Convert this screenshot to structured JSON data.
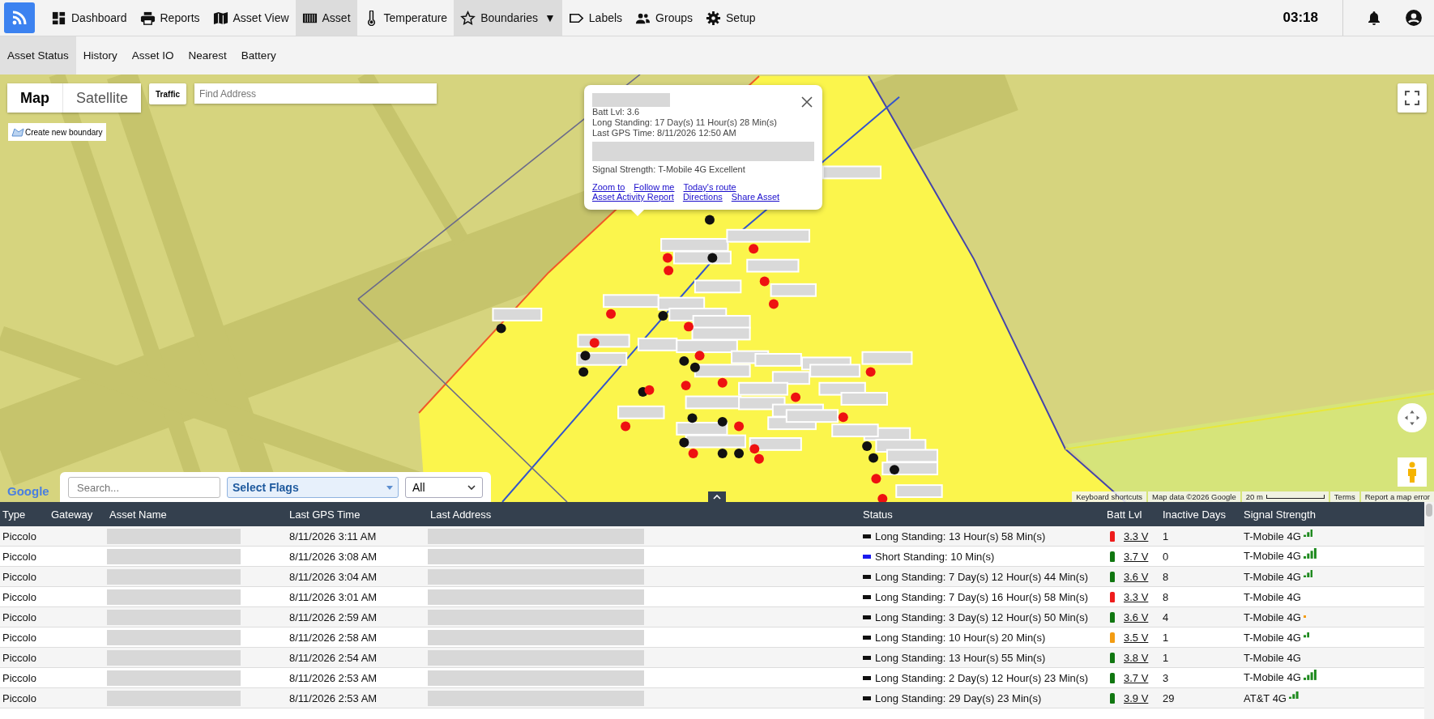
{
  "top_nav": {
    "items": [
      {
        "label": "Dashboard",
        "selected": false
      },
      {
        "label": "Reports",
        "selected": false
      },
      {
        "label": "Asset View",
        "selected": false
      },
      {
        "label": "Asset",
        "selected": true
      },
      {
        "label": "Temperature",
        "selected": false
      },
      {
        "label": "Boundaries",
        "caret": "▼",
        "selected": true
      },
      {
        "label": "Labels",
        "selected": false
      },
      {
        "label": "Groups",
        "selected": false
      },
      {
        "label": "Setup",
        "selected": false
      }
    ],
    "clock": "03:18"
  },
  "sub_nav": {
    "items": [
      {
        "label": "Asset Status",
        "selected": true
      },
      {
        "label": "History",
        "selected": false
      },
      {
        "label": "Asset IO",
        "selected": false
      },
      {
        "label": "Nearest",
        "selected": false
      },
      {
        "label": "Battery",
        "selected": false
      }
    ]
  },
  "map": {
    "type_toggle": [
      {
        "label": "Map",
        "selected": true
      },
      {
        "label": "Satellite",
        "selected": false
      }
    ],
    "traffic_button": "Traffic",
    "address_search": {
      "placeholder": "Find Address"
    },
    "create_boundary_button": "Create new boundary",
    "logo": "Google",
    "attribution": [
      "Keyboard shortcuts",
      "Map data ©2026 Google",
      "20 m",
      "Terms",
      "Report a map error"
    ],
    "popup": {
      "lines": [
        "Batt Lvl: 3.6",
        "Long Standing: 17 Day(s) 11 Hour(s) 28 Min(s)",
        "Last GPS Time: 8/11/2026 12:50 AM"
      ],
      "signal_line": "Signal Strength: T-Mobile 4G Excellent",
      "links": [
        [
          "Zoom to",
          "Follow me",
          "Today's route"
        ],
        [
          "Asset Activity Report",
          "Directions",
          "Share Asset"
        ]
      ]
    }
  },
  "filters": {
    "search": {
      "placeholder": "Search..."
    },
    "flags": {
      "value": "Select Flags"
    },
    "scope": {
      "value": "All"
    }
  },
  "table": {
    "columns": [
      "Type",
      "Gateway",
      "Asset Name",
      "Last GPS Time",
      "Last Address",
      "Status",
      "Batt Lvl",
      "Inactive Days",
      "Signal Strength"
    ],
    "rows": [
      {
        "type": "Piccolo",
        "last_gps_time": "8/11/2026 3:11 AM",
        "status": {
          "text": "Long Standing: 13 Hour(s) 58 Min(s)",
          "color": "#111111"
        },
        "batt": {
          "text": "3.3 V",
          "color": "#ee1c1c"
        },
        "inactive_days": "1",
        "signal": {
          "text": "T-Mobile 4G",
          "kind": "good"
        }
      },
      {
        "type": "Piccolo",
        "last_gps_time": "8/11/2026 3:08 AM",
        "status": {
          "text": "Short Standing: 10 Min(s)",
          "color": "#1a1aee"
        },
        "batt": {
          "text": "3.7 V",
          "color": "#117711"
        },
        "inactive_days": "0",
        "signal": {
          "text": "T-Mobile 4G",
          "kind": "excellent"
        }
      },
      {
        "type": "Piccolo",
        "last_gps_time": "8/11/2026 3:04 AM",
        "status": {
          "text": "Long Standing: 7 Day(s) 12 Hour(s) 44 Min(s)",
          "color": "#111111"
        },
        "batt": {
          "text": "3.6 V",
          "color": "#117711"
        },
        "inactive_days": "8",
        "signal": {
          "text": "T-Mobile 4G",
          "kind": "good"
        }
      },
      {
        "type": "Piccolo",
        "last_gps_time": "8/11/2026 3:01 AM",
        "status": {
          "text": "Long Standing: 7 Day(s) 16 Hour(s) 58 Min(s)",
          "color": "#111111"
        },
        "batt": {
          "text": "3.3 V",
          "color": "#ee1c1c"
        },
        "inactive_days": "8",
        "signal": {
          "text": "T-Mobile 4G",
          "kind": "none"
        }
      },
      {
        "type": "Piccolo",
        "last_gps_time": "8/11/2026 2:59 AM",
        "status": {
          "text": "Long Standing: 3 Day(s) 12 Hour(s) 50 Min(s)",
          "color": "#111111"
        },
        "batt": {
          "text": "3.6 V",
          "color": "#117711"
        },
        "inactive_days": "4",
        "signal": {
          "text": "T-Mobile 4G",
          "kind": "poor"
        }
      },
      {
        "type": "Piccolo",
        "last_gps_time": "8/11/2026 2:58 AM",
        "status": {
          "text": "Long Standing: 10 Hour(s) 20 Min(s)",
          "color": "#111111"
        },
        "batt": {
          "text": "3.5 V",
          "color": "#f39c12"
        },
        "inactive_days": "1",
        "signal": {
          "text": "T-Mobile 4G",
          "kind": "fair"
        }
      },
      {
        "type": "Piccolo",
        "last_gps_time": "8/11/2026 2:54 AM",
        "status": {
          "text": "Long Standing: 13 Hour(s) 55 Min(s)",
          "color": "#111111"
        },
        "batt": {
          "text": "3.8 V",
          "color": "#117711"
        },
        "inactive_days": "1",
        "signal": {
          "text": "T-Mobile 4G",
          "kind": "none"
        }
      },
      {
        "type": "Piccolo",
        "last_gps_time": "8/11/2026 2:53 AM",
        "status": {
          "text": "Long Standing: 2 Day(s) 12 Hour(s) 23 Min(s)",
          "color": "#111111"
        },
        "batt": {
          "text": "3.7 V",
          "color": "#117711"
        },
        "inactive_days": "3",
        "signal": {
          "text": "T-Mobile 4G",
          "kind": "excellent"
        }
      },
      {
        "type": "Piccolo",
        "last_gps_time": "8/11/2026 2:53 AM",
        "status": {
          "text": "Long Standing: 29 Day(s) 23 Min(s)",
          "color": "#111111"
        },
        "batt": {
          "text": "3.9 V",
          "color": "#117711"
        },
        "inactive_days": "29",
        "signal": {
          "text": "AT&T 4G",
          "kind": "good"
        }
      }
    ]
  }
}
